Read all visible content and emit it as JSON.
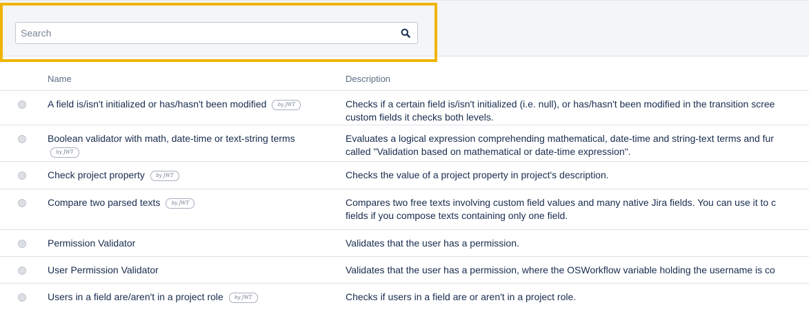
{
  "search": {
    "placeholder": "Search",
    "value": ""
  },
  "table": {
    "columns": {
      "name": "Name",
      "description": "Description"
    },
    "rows": [
      {
        "name": "A field is/isn't initialized or has/hasn't been modified",
        "badge": "by JWT",
        "description_lines": [
          "Checks if a certain field is/isn't initialized (i.e. null), or has/hasn't been modified in the transition scree",
          "custom fields it checks both levels."
        ]
      },
      {
        "name": "Boolean validator with math, date-time or text-string terms",
        "badge": "by JWT",
        "description_lines": [
          "Evaluates a logical expression comprehending mathematical, date-time and string-text terms and fur",
          "called \"Validation based on mathematical or date-time expression\"."
        ]
      },
      {
        "name": "Check project property",
        "badge": "by JWT",
        "description_lines": [
          "Checks the value of a project property in project's description."
        ]
      },
      {
        "name": "Compare two parsed texts",
        "badge": "by JWT",
        "description_lines": [
          "Compares two free texts involving custom field values and many native Jira fields. You can use it to c",
          "fields if you compose texts containing only one field."
        ]
      },
      {
        "name": "Permission Validator",
        "badge": "",
        "description_lines": [
          "Validates that the user has a permission."
        ]
      },
      {
        "name": "User Permission Validator",
        "badge": "",
        "description_lines": [
          "Validates that the user has a permission, where the OSWorkflow variable holding the username is co"
        ]
      },
      {
        "name": "Users in a field are/aren't in a project role",
        "badge": "by JWT",
        "description_lines": [
          "Checks if users in a field are or aren't in a project role."
        ]
      }
    ]
  }
}
